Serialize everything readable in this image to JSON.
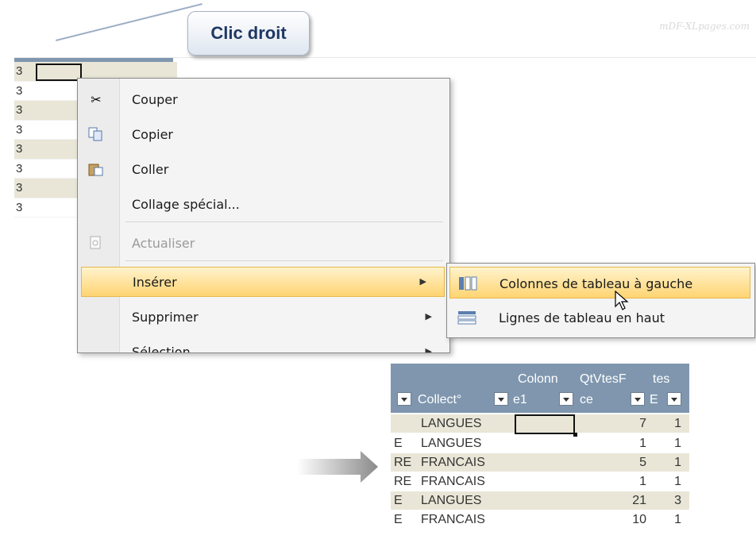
{
  "watermark": "mDF-XLpages.com",
  "callout": "Clic droit",
  "background_rows": [
    "3",
    "3",
    "3",
    "3",
    "3",
    "3",
    "3",
    "3"
  ],
  "context_menu": {
    "items": [
      {
        "label": "Couper",
        "icon": "scissors-icon"
      },
      {
        "label": "Copier",
        "icon": "copy-icon"
      },
      {
        "label": "Coller",
        "icon": "paste-icon"
      },
      {
        "label": "Collage spécial...",
        "icon": ""
      },
      {
        "label": "Actualiser",
        "icon": "refresh-icon",
        "disabled": true
      },
      {
        "label": "Insérer",
        "icon": "",
        "submenu": true,
        "highlighted": true
      },
      {
        "label": "Supprimer",
        "icon": "",
        "submenu": true
      },
      {
        "label": "Sélection",
        "icon": "",
        "submenu": true
      }
    ]
  },
  "submenu": {
    "items": [
      {
        "label": "Colonnes de tableau à gauche",
        "icon": "insert-columns-icon",
        "highlighted": true
      },
      {
        "label": "Lignes de tableau en haut",
        "icon": "insert-rows-icon"
      }
    ]
  },
  "result_table": {
    "headers": {
      "collect": "Collect°",
      "colonne1_line1": "Colonn",
      "colonne1_line2": "e1",
      "qtvtes_line1": "QtVtesF",
      "qtvtes_line2": "ce",
      "tes_line1": "tes",
      "tes_line2": "E"
    },
    "rows": [
      {
        "pre": "",
        "collect": "LANGUES",
        "qt": "7",
        "tes": "1"
      },
      {
        "pre": "E",
        "collect": "LANGUES",
        "qt": "1",
        "tes": "1"
      },
      {
        "pre": "RE",
        "collect": "FRANCAIS",
        "qt": "5",
        "tes": "1"
      },
      {
        "pre": "RE",
        "collect": "FRANCAIS",
        "qt": "1",
        "tes": "1"
      },
      {
        "pre": "E",
        "collect": "LANGUES",
        "qt": "21",
        "tes": "3"
      },
      {
        "pre": "E",
        "collect": "FRANCAIS",
        "qt": "10",
        "tes": "1"
      }
    ]
  },
  "colors": {
    "header": "#7f96ae",
    "band": "#e9e6d7",
    "highlight": "#ffd472"
  }
}
